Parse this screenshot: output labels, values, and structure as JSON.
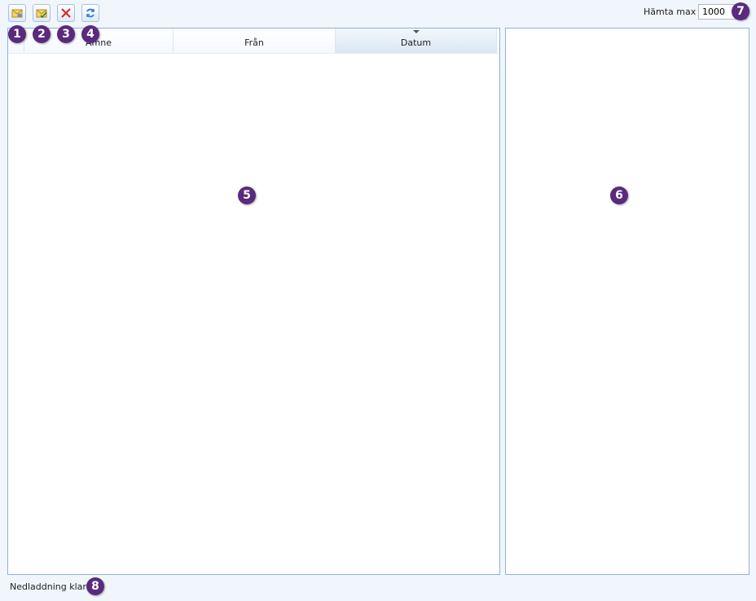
{
  "toolbar": {
    "buttons": [
      {
        "icon": "mail-folder-icon"
      },
      {
        "icon": "mail-check-icon"
      },
      {
        "icon": "delete-x-icon"
      },
      {
        "icon": "refresh-icon"
      }
    ],
    "fetch_label": "Hämta max",
    "fetch_value": "1000"
  },
  "list": {
    "columns": [
      "Ämne",
      "Från",
      "Datum"
    ],
    "sorted_column": "Datum"
  },
  "status": {
    "text": "Nedladdning klar"
  },
  "callouts": [
    "1",
    "2",
    "3",
    "4",
    "5",
    "6",
    "7",
    "8"
  ],
  "colors": {
    "badge": "#5a2a7e",
    "pane_border": "#8fb2d6",
    "background": "#f1f6fc"
  }
}
